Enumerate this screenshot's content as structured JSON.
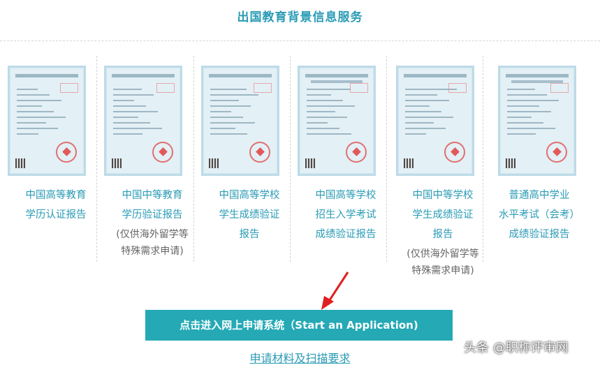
{
  "page": {
    "title": "出国教育背景信息服务"
  },
  "cards": [
    {
      "label_lines": [
        "中国高等教育",
        "学历认证报告"
      ],
      "note_lines": []
    },
    {
      "label_lines": [
        "中国中等教育",
        "学历验证报告"
      ],
      "note_lines": [
        "(仅供海外留学等",
        "特殊需求申请)"
      ]
    },
    {
      "label_lines": [
        "中国高等学校",
        "学生成绩验证",
        "报告"
      ],
      "note_lines": []
    },
    {
      "label_lines": [
        "中国高等学校",
        "招生入学考试",
        "成绩验证报告"
      ],
      "note_lines": []
    },
    {
      "label_lines": [
        "中国中等学校",
        "学生成绩验证",
        "报告"
      ],
      "note_lines": [
        "(仅供海外留学等",
        "特殊需求申请)"
      ]
    },
    {
      "label_lines": [
        "普通高中学业",
        "水平考试（会考）",
        "成绩验证报告"
      ],
      "note_lines": []
    }
  ],
  "actions": {
    "apply_button": "点击进入网上申请系统（Start an Application)",
    "requirements_link": "申请材料及扫描要求"
  },
  "watermark": "头条 @职称评审网",
  "colors": {
    "accent": "#2a9bb5",
    "button": "#24a9b5",
    "arrow": "#e02020"
  },
  "icons": {
    "arrow": "red-arrow-icon"
  }
}
